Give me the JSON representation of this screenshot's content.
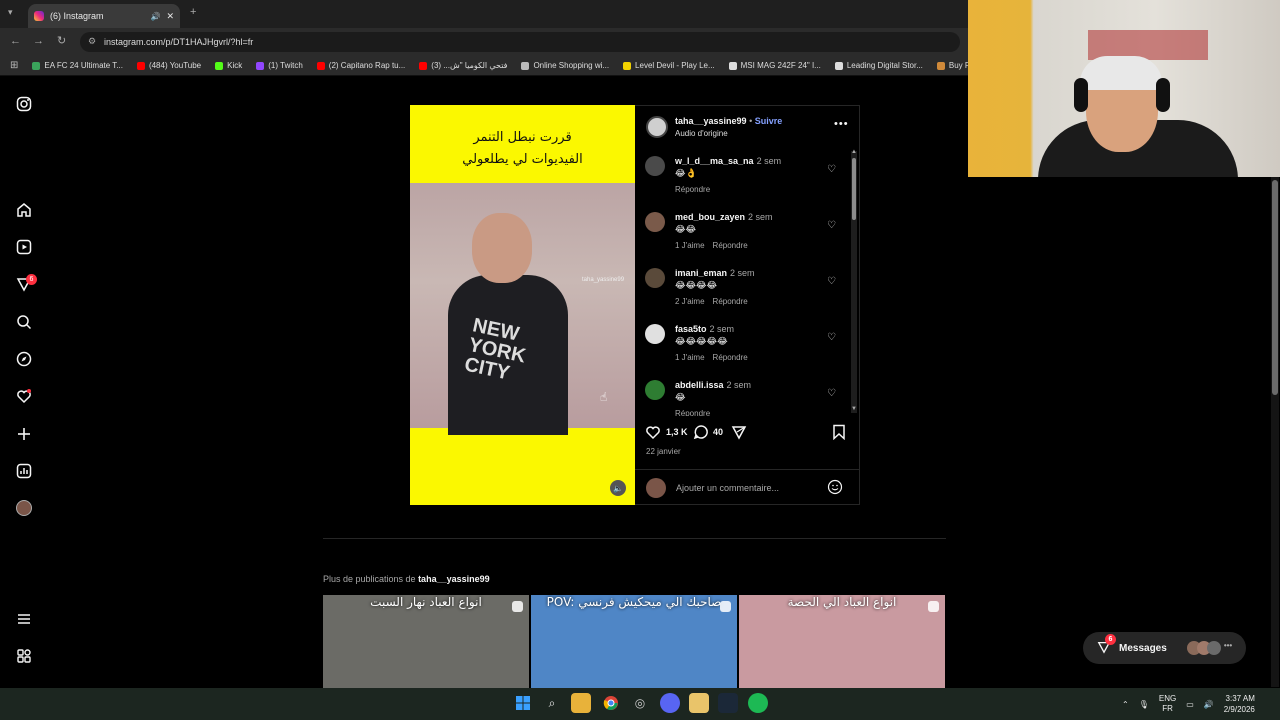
{
  "browser": {
    "tab_title": "(6) Instagram",
    "url": "instagram.com/p/DT1HAJHgvrl/?hl=fr",
    "bookmarks": [
      {
        "label": "EA FC 24 Ultimate T...",
        "color": "#3aa35b"
      },
      {
        "label": "(484) YouTube",
        "color": "#ff0000"
      },
      {
        "label": "Kick",
        "color": "#53fc18"
      },
      {
        "label": "(1) Twitch",
        "color": "#9146ff"
      },
      {
        "label": "(2) Capitano Rap tu...",
        "color": "#ff0000"
      },
      {
        "label": "فتحي الكوميا \"ش... (3)",
        "color": "#ff0000"
      },
      {
        "label": "Online Shopping wi...",
        "color": "#bbbbbb"
      },
      {
        "label": "Level Devil - Play Le...",
        "color": "#f2d200"
      },
      {
        "label": "MSI MAG 242F 24\" I...",
        "color": "#dddddd"
      },
      {
        "label": "Leading Digital Stor...",
        "color": "#dddddd"
      },
      {
        "label": "Buy P",
        "color": "#d08a3a"
      }
    ]
  },
  "nav": {
    "notifications_badge": "6"
  },
  "post": {
    "caption_line1": "قررت نبطل التنمر",
    "caption_line2": "الفيديوات لي يطلعولي",
    "shirt_text": "NEW YORK CITY",
    "watermark": "taha_yassine99",
    "author": "taha__yassine99",
    "follow": "Suivre",
    "audio": "Audio d'origine",
    "likes": "1,3 K",
    "comments_count": "40",
    "date": "22 janvier",
    "add_comment_placeholder": "Ajouter un commentaire..."
  },
  "comments": [
    {
      "user": "w_l_d__ma_sa_na",
      "time": "2 sem",
      "emojis": "😂👌",
      "likes": "",
      "reply": "Répondre",
      "avatar_color": "#4a4a4a"
    },
    {
      "user": "med_bou_zayen",
      "time": "2 sem",
      "emojis": "😂😂",
      "likes": "1 J'aime",
      "reply": "Répondre",
      "avatar_color": "#7a5a4a"
    },
    {
      "user": "imani_eman",
      "time": "2 sem",
      "emojis": "😂😂😂😂",
      "likes": "2 J'aime",
      "reply": "Répondre",
      "avatar_color": "#5a4a3a"
    },
    {
      "user": "fasa5to",
      "time": "2 sem",
      "emojis": "😂😂😂😂😂",
      "likes": "1 J'aime",
      "reply": "Répondre",
      "avatar_color": "#e0e0e0"
    },
    {
      "user": "abdelli.issa",
      "time": "2 sem",
      "emojis": "😂",
      "likes": "",
      "reply": "Répondre",
      "avatar_color": "#2e7d32"
    }
  ],
  "more": {
    "prefix": "Plus de publications de ",
    "user": "taha__yassine99",
    "thumbs": [
      {
        "caption": "انواع العباد نهار السبت",
        "bg": "#6b6b66"
      },
      {
        "caption": "POV: صاحبك الي ميحكيش فرنسي",
        "bg": "#4f86c6"
      },
      {
        "caption": "انواع العباد الي الحصة",
        "bg": "#c99aa0"
      }
    ]
  },
  "messages": {
    "label": "Messages",
    "badge": "6"
  },
  "taskbar": {
    "lang1": "ENG",
    "lang2": "FR",
    "time": "3:37 AM",
    "date": "2/9/2026"
  }
}
